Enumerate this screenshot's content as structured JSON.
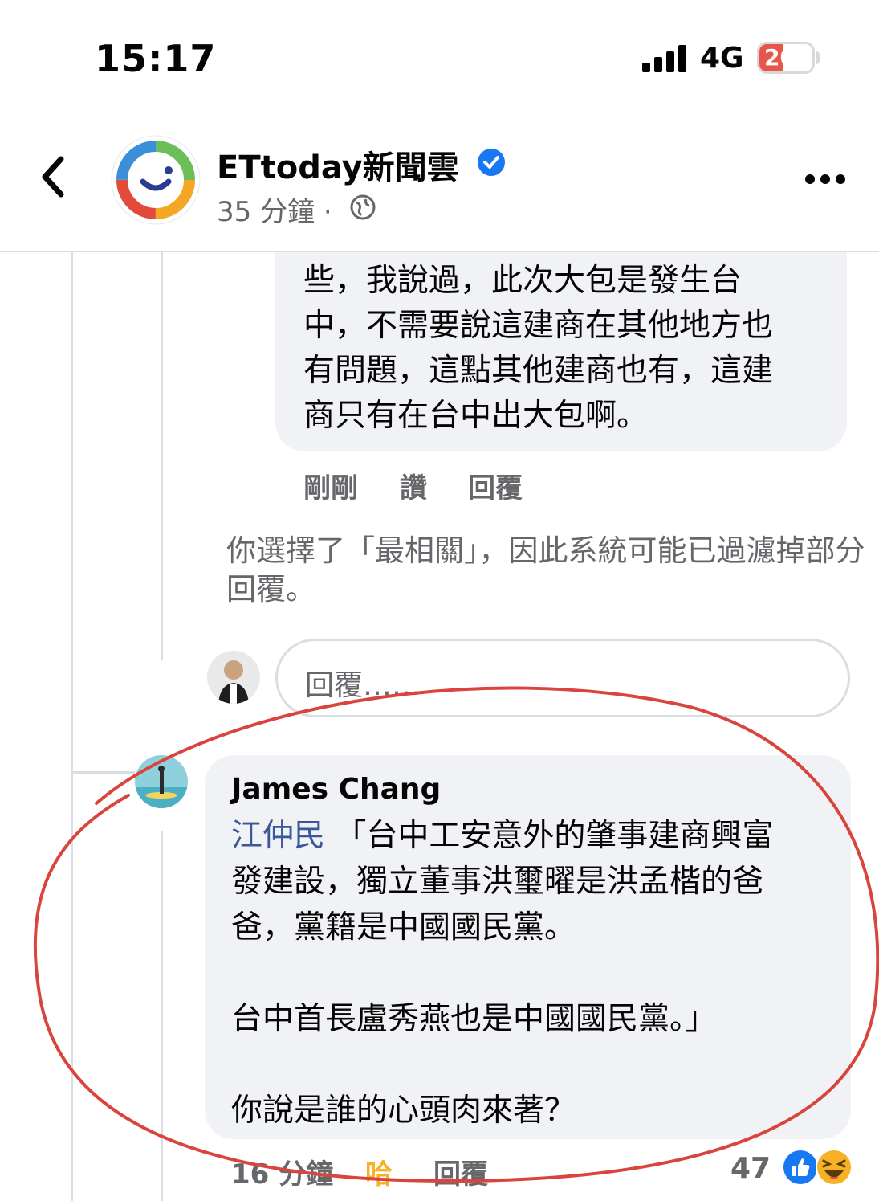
{
  "status_bar": {
    "time": "15:17",
    "network": "4G",
    "battery": "20",
    "battery_level": 0.2
  },
  "header": {
    "page_name": "ETtoday新聞雲",
    "post_time": "35 分鐘 ·"
  },
  "comment_reply": {
    "text": "些，我說過，此次大包是發生台\n中，不需要說這建商在其他地方也\n有問題，這點其他建商也有，這建\n商只有在台中出大包啊。",
    "actions": {
      "time": "剛剛",
      "like": "讚",
      "reply": "回覆"
    }
  },
  "filter_notice": "你選擇了「最相關」，因此系統可能已過濾掉部分回覆。",
  "reply_input": {
    "placeholder": "回覆……"
  },
  "james_comment": {
    "author": "James Chang",
    "mention": "江仲民",
    "text": "「台中工安意外的肇事建商興富\n發建設，獨立董事洪璽曜是洪孟楷的爸\n爸，黨籍是中國國民黨。\n\n台中首長盧秀燕也是中國國民黨。」\n\n你說是誰的心頭肉來著？",
    "actions": {
      "time": "16 分鐘",
      "haha": "哈",
      "reply": "回覆"
    },
    "reaction_count": "47"
  },
  "colors": {
    "accent": "#1877f2",
    "annotation": "#d9443c",
    "haha_action": "#f7b125"
  }
}
